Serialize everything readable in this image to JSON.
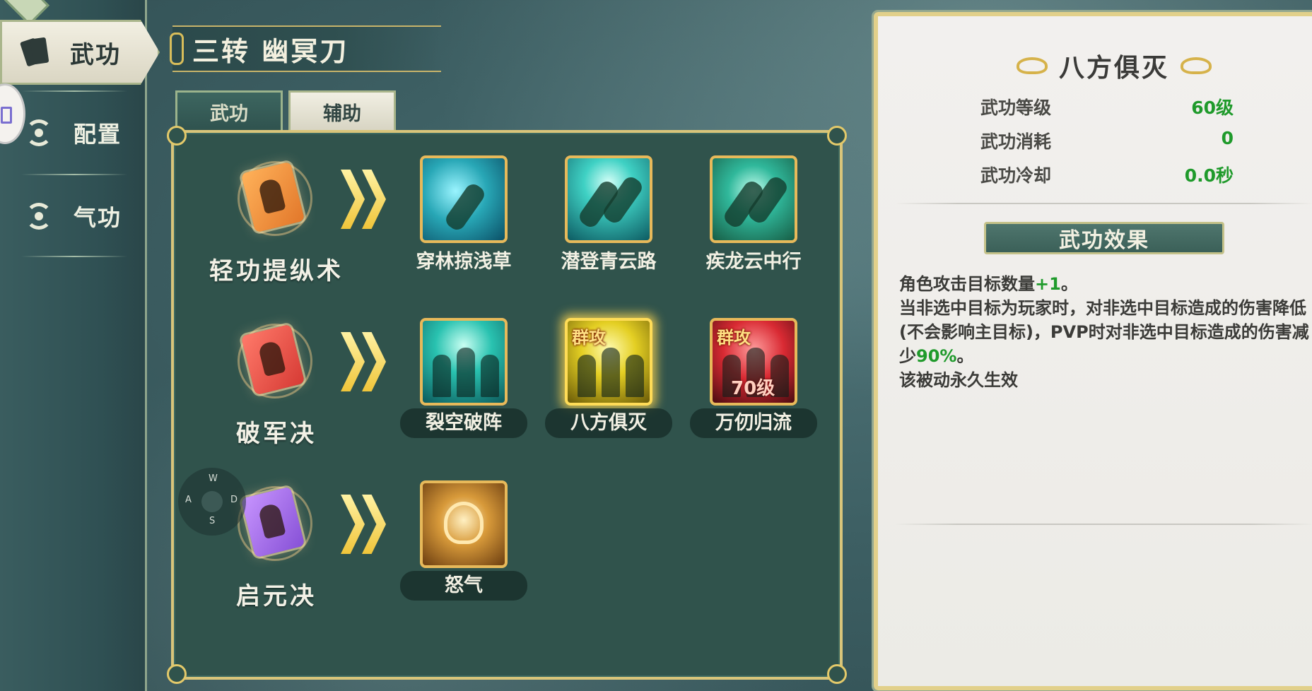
{
  "sidebar": {
    "active": {
      "label": "武功",
      "icon": "cards-icon"
    },
    "items": [
      {
        "label": "配置",
        "icon": "swirl-icon"
      },
      {
        "label": "气功",
        "icon": "swirl-icon"
      }
    ]
  },
  "weapon": {
    "title": "三转 幽冥刀"
  },
  "tabs": [
    {
      "label": "武功",
      "active": false
    },
    {
      "label": "辅助",
      "active": true
    }
  ],
  "rows": [
    {
      "name": "轻功提纵术",
      "book_color": "orange",
      "skills": [
        {
          "name": "穿林掠浅草",
          "badge": "",
          "level": ""
        },
        {
          "name": "潜登青云路",
          "badge": "",
          "level": ""
        },
        {
          "name": "疾龙云中行",
          "badge": "",
          "level": ""
        }
      ]
    },
    {
      "name": "破军决",
      "book_color": "red",
      "skills": [
        {
          "name": "裂空破阵",
          "badge": "",
          "level": ""
        },
        {
          "name": "八方俱灭",
          "badge": "群攻",
          "level": "",
          "selected": true
        },
        {
          "name": "万仞归流",
          "badge": "群攻",
          "level": "70级"
        }
      ]
    },
    {
      "name": "启元决",
      "book_color": "purple",
      "skills": [
        {
          "name": "怒气",
          "badge": "",
          "level": ""
        }
      ]
    }
  ],
  "joystick": {
    "up": "W",
    "left": "A",
    "right": "D",
    "down": "S"
  },
  "info": {
    "title": "八方俱灭",
    "stats": [
      {
        "key": "武功等级",
        "value": "60级"
      },
      {
        "key": "武功消耗",
        "value": "0"
      },
      {
        "key": "武功冷却",
        "value": "0.0秒"
      }
    ],
    "effect_label": "武功效果",
    "desc": {
      "line1_a": "角色攻击目标数量",
      "line1_hl": "+1",
      "line1_b": "。",
      "line2_a": "当非选中目标为玩家时，对非选中目标造成的伤害降低(不会影响主目标)，PVP时对非选中目标造成的伤害减少",
      "line2_hl": "90%",
      "line2_b": "。",
      "line3": "该被动永久生效"
    }
  },
  "colors": {
    "accent_green": "#1f9a2b",
    "gold_border": "#e3c96a",
    "panel_bg": "#30534c"
  }
}
